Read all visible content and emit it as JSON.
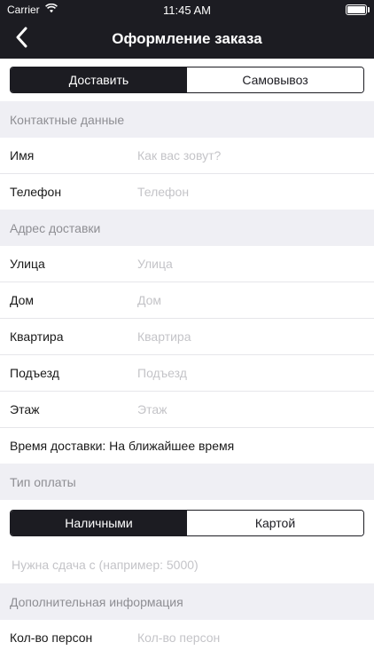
{
  "status": {
    "carrier": "Carrier",
    "time": "11:45 AM"
  },
  "nav": {
    "title": "Оформление заказа"
  },
  "delivery_mode": {
    "options": [
      "Доставить",
      "Самовывоз"
    ],
    "selected": 0
  },
  "contact": {
    "header": "Контактные данные",
    "fields": [
      {
        "label": "Имя",
        "placeholder": "Как вас зовут?"
      },
      {
        "label": "Телефон",
        "placeholder": "Телефон"
      }
    ]
  },
  "address": {
    "header": "Адрес доставки",
    "fields": [
      {
        "label": "Улица",
        "placeholder": "Улица"
      },
      {
        "label": "Дом",
        "placeholder": "Дом"
      },
      {
        "label": "Квартира",
        "placeholder": "Квартира"
      },
      {
        "label": "Подъезд",
        "placeholder": "Подъезд"
      },
      {
        "label": "Этаж",
        "placeholder": "Этаж"
      }
    ],
    "delivery_time": "Время доставки: На ближайшее время"
  },
  "payment": {
    "header": "Тип оплаты",
    "options": [
      "Наличными",
      "Картой"
    ],
    "selected": 0,
    "change_placeholder": "Нужна сдача с (например: 5000)"
  },
  "extra": {
    "header": "Дополнительная информация",
    "fields": [
      {
        "label": "Кол-во персон",
        "placeholder": "Кол-во персон"
      }
    ]
  }
}
